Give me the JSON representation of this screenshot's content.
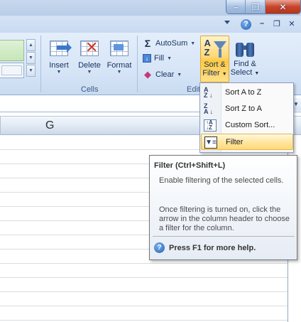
{
  "window": {
    "minimize_glyph": "–",
    "maximize_glyph": "❐",
    "close_glyph": "✕",
    "help_glyph": "?",
    "doc_minimize_glyph": "–",
    "doc_restore_glyph": "❐",
    "doc_close_glyph": "✕"
  },
  "ribbon": {
    "cells_group": {
      "label": "Cells",
      "insert": "Insert",
      "delete": "Delete",
      "format": "Format"
    },
    "editing_group": {
      "label_partial": "Edit",
      "autosum": "AutoSum",
      "fill": "Fill",
      "clear": "Clear",
      "sort_filter_line1": "Sort &",
      "sort_filter_line2": "Filter",
      "find_select_line1": "Find &",
      "find_select_line2": "Select"
    }
  },
  "sheet": {
    "column_header": "G"
  },
  "menu": {
    "items": [
      {
        "label": "Sort A to Z",
        "icon": "sort-a-to-z-icon"
      },
      {
        "label": "Sort Z to A",
        "icon": "sort-z-to-a-icon"
      },
      {
        "label": "Custom Sort...",
        "icon": "custom-sort-icon"
      },
      {
        "label": "Filter",
        "icon": "filter-icon",
        "highlighted": true
      }
    ]
  },
  "tooltip": {
    "title": "Filter (Ctrl+Shift+L)",
    "description": "Enable filtering of the selected cells.",
    "details": "Once filtering is turned on, click the arrow in the column header to choose a filter for the column.",
    "help": "Press F1 for more help."
  },
  "colors": {
    "ribbon_bg": "#d7e5f7",
    "highlight": "#ffd977",
    "close_red": "#c7452c",
    "accent_blue": "#1f5fb5"
  }
}
